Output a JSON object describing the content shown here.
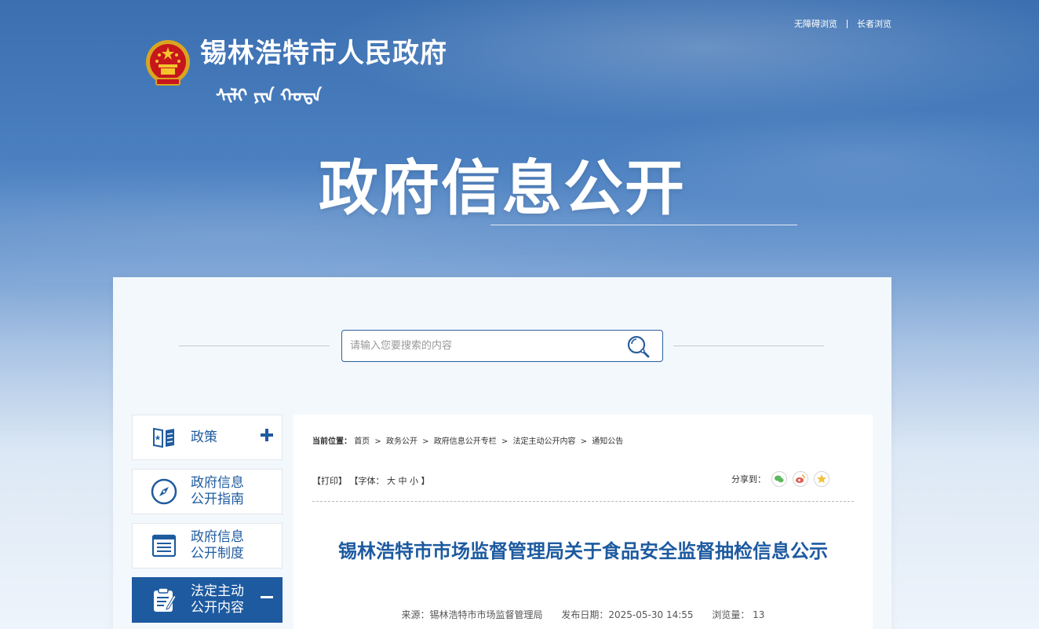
{
  "colors": {
    "brand": "#1d5aa0",
    "banner": "#3b6fb0",
    "panel": "#f3f8fd"
  },
  "header": {
    "links": [
      "无障碍浏览",
      "长者浏览"
    ],
    "site_title": "锡林浩特市人民政府",
    "mongolian_text": "ᠰᠢᠯᠢ ᠶᠢᠨ ᠬᠣᠲᠠ",
    "big_title": "政府信息公开"
  },
  "search": {
    "placeholder": "请输入您要搜索的内容",
    "icon": "search-icon"
  },
  "sidebar": {
    "items": [
      {
        "label": "政策",
        "icon": "policy-book-icon",
        "toggle": "+"
      },
      {
        "label": "政府信息\n公开指南",
        "icon": "compass-icon"
      },
      {
        "label": "政府信息\n公开制度",
        "icon": "document-list-icon"
      },
      {
        "label": "法定主动\n公开内容",
        "icon": "clipboard-icon",
        "toggle": "−"
      }
    ]
  },
  "breadcrumb": {
    "prefix": "当前位置：",
    "items": [
      "首页",
      "政务公开",
      "政府信息公开专栏",
      "法定主动公开内容",
      "通知公告"
    ],
    "separator": ">"
  },
  "tools": {
    "print": "【打印】",
    "font_prefix": "【字体：",
    "font_large": "大",
    "font_medium": "中",
    "font_small": "小",
    "font_suffix": "】",
    "share_label": "分享到："
  },
  "article": {
    "title": "锡林浩特市市场监督管理局关于食品安全监督抽检信息公示",
    "source": "来源：锡林浩特市市场监督管理局",
    "date": "发布日期：2025-05-30 14:55",
    "views": "浏览量： 13"
  }
}
